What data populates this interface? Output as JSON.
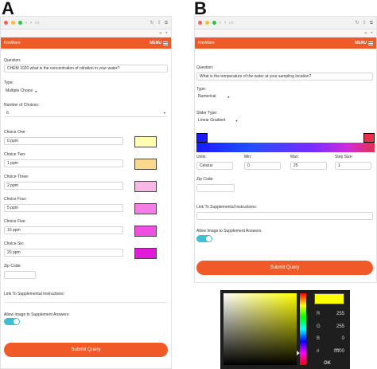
{
  "panel_a": {
    "letter": "A",
    "app_brand": "KnoWare",
    "menu_label": "MENU",
    "question_label": "Question:",
    "question_value": "CHEM 1020 what is the concentration of nitration in your water?",
    "type_label": "Type:",
    "type_value": "Multiple Choice",
    "num_choices_label": "Number of Choices:",
    "num_choices_value": "6",
    "choices": [
      {
        "label": "Choice One:",
        "value": "0 ppm",
        "color": "#fffdb0"
      },
      {
        "label": "Choice Two:",
        "value": "1 ppm",
        "color": "#fbd98c"
      },
      {
        "label": "Choice Three:",
        "value": "2 ppm",
        "color": "#f7b8e6"
      },
      {
        "label": "Choice Four:",
        "value": "5 ppm",
        "color": "#f57ee6"
      },
      {
        "label": "Choice Five:",
        "value": "10 ppm",
        "color": "#ef4fe0"
      },
      {
        "label": "Choice Six:",
        "value": "20 ppm",
        "color": "#e21bd8"
      }
    ],
    "zip_label": "Zip Code:",
    "link_label": "Link To Supplemental Instructions:",
    "allow_image_label": "Allow Image to Supplement Answers:",
    "submit_label": "Submit Query"
  },
  "panel_b": {
    "letter": "B",
    "app_brand": "KnoWare",
    "menu_label": "MENU",
    "question_label": "Question:",
    "question_value": "What is the temperature of the water at your sampling location?",
    "type_label": "Type:",
    "type_value": "Numerical",
    "slider_type_label": "Slider Type:",
    "slider_type_value": "Linear Gradient",
    "units_label": "Units:",
    "units_value": "Celsius",
    "min_label": "Min:",
    "min_value": "0",
    "max_label": "Max:",
    "max_value": "25",
    "step_label": "Step Size:",
    "step_value": "1",
    "zip_label": "Zip Code:",
    "link_label": "Link To Supplemental Instructions:",
    "allow_image_label": "Allow Image to Supplement Answers:",
    "submit_label": "Submit Query"
  },
  "color_picker": {
    "r_label": "R",
    "r_value": "255",
    "g_label": "G",
    "g_value": "255",
    "b_label": "B",
    "b_value": "0",
    "hex_label": "#",
    "hex_value": "ffff00",
    "ok_label": "OK",
    "selected_color": "#ffff00"
  },
  "colors": {
    "accent": "#f05a28",
    "toggle": "#3fbfd2"
  }
}
